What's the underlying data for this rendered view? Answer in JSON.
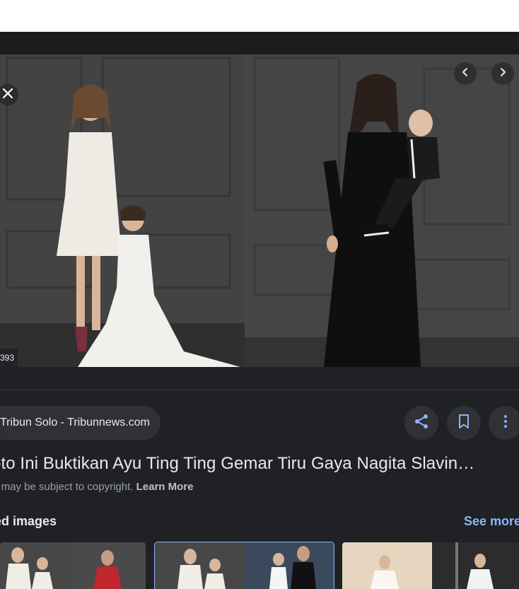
{
  "image": {
    "dimensions_label": "393"
  },
  "source": {
    "label": "Tribun Solo - Tribunnews.com"
  },
  "title": "oto Ini Buktikan Ayu Ting Ting Gemar Tiru Gaya Nagita Slavin…",
  "copyright": {
    "text": "s may be subject to copyright. ",
    "learn_more": "Learn More"
  },
  "related": {
    "heading": "ed images",
    "see_more": "See more"
  },
  "colors": {
    "panel_bg": "#202124",
    "accent": "#8ab4f8",
    "button_bg": "#303134"
  },
  "icons": [
    "close-icon",
    "chevron-left-icon",
    "chevron-right-icon",
    "share-icon",
    "bookmark-icon",
    "more-vert-icon"
  ]
}
